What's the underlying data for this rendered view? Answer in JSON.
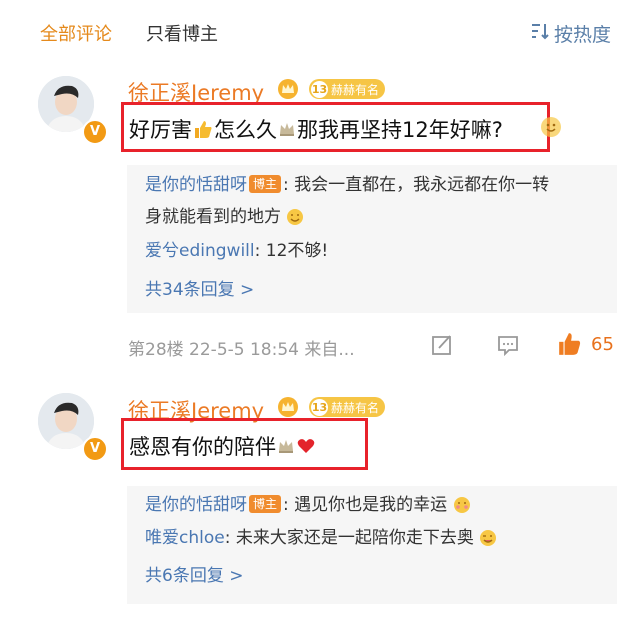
{
  "tabs": {
    "all": "全部评论",
    "host_only": "只看博主",
    "sort": "按热度"
  },
  "colors": {
    "accent": "#eb7a25",
    "link": "#4a77b2",
    "highlight": "#e8222b",
    "meta": "#9a9a9a"
  },
  "comments": [
    {
      "username": "徐正溪Jeremy",
      "fan_level": "13",
      "fan_label": "赫赫有名",
      "text_parts": [
        "好厉害",
        "怎么久",
        "那我再坚持12年好嘛?"
      ],
      "emojis": [
        "thumbs-up",
        "crown",
        "smile"
      ],
      "replies": [
        {
          "name": "是你的恬甜呀",
          "tag": "博主",
          "line1": ": 我会一直都在，我永远都在你一转",
          "line2": "身就能看到的地方"
        },
        {
          "name": "爱兮edingwill",
          "text": ": 12不够!"
        }
      ],
      "more": "共34条回复 >",
      "floor": "第28楼",
      "time": "22-5-5 18:54",
      "source": "来自...",
      "likes": "65"
    },
    {
      "username": "徐正溪Jeremy",
      "fan_level": "13",
      "fan_label": "赫赫有名",
      "text": "感恩有你的陪伴",
      "emojis": [
        "crown",
        "heart"
      ],
      "replies": [
        {
          "name": "是你的恬甜呀",
          "tag": "博主",
          "text": ": 遇见你也是我的幸运"
        },
        {
          "name": "唯爱chloe",
          "text": ": 未来大家还是一起陪你走下去奥"
        }
      ],
      "more": "共6条回复 >"
    }
  ]
}
